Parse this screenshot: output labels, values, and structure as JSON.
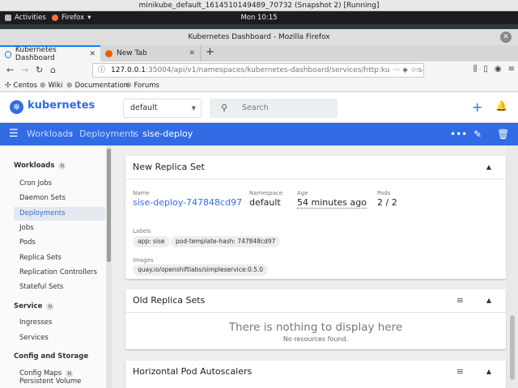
{
  "vm": {
    "title": "minikube_default_1614510149489_70732 (Snapshot 2) [Running]"
  },
  "gnome": {
    "activities": "Activities",
    "app": "Firefox",
    "clock": "Mon 10:15"
  },
  "firefox": {
    "window_title": "Kubernetes Dashboard - Mozilla Firefox",
    "tabs": [
      {
        "label": "Kubernetes Dashboard"
      },
      {
        "label": "New Tab"
      }
    ],
    "url_host": "127.0.0.1",
    "url_path": ":35004/api/v1/namespaces/kubernetes-dashboard/services/http:kubernetes-",
    "bookmarks": [
      {
        "label": "Centos"
      },
      {
        "label": "Wiki"
      },
      {
        "label": "Documentation"
      },
      {
        "label": "Forums"
      }
    ]
  },
  "k8s": {
    "brand": "kubernetes",
    "namespace": "default",
    "search_placeholder": "Search"
  },
  "breadcrumb": {
    "workloads": "Workloads",
    "deployments": "Deployments",
    "current": "sise-deploy"
  },
  "sidebar": {
    "sections": [
      {
        "label": "Workloads",
        "badge": "N"
      },
      {
        "label": "Service",
        "badge": "N"
      },
      {
        "label": "Config and Storage"
      }
    ],
    "items": [
      {
        "label": "Cron Jobs"
      },
      {
        "label": "Daemon Sets"
      },
      {
        "label": "Deployments"
      },
      {
        "label": "Jobs"
      },
      {
        "label": "Pods"
      },
      {
        "label": "Replica Sets"
      },
      {
        "label": "Replication Controllers"
      },
      {
        "label": "Stateful Sets"
      },
      {
        "label": "Ingresses"
      },
      {
        "label": "Services"
      },
      {
        "label": "Config Maps",
        "badge": "N"
      },
      {
        "label": "Persistent Volume Claims"
      }
    ]
  },
  "new_rs": {
    "title": "New Replica Set",
    "name_label": "Name",
    "name": "sise-deploy-747848cd97",
    "namespace_label": "Namespace",
    "namespace": "default",
    "age_label": "Age",
    "age": "54 minutes ago",
    "pods_label": "Pods",
    "pods": "2 / 2",
    "labels_label": "Labels",
    "labels": [
      "app: sise",
      "pod-template-hash: 747848cd97"
    ],
    "images_label": "Images",
    "images": [
      "quay.io/openshiftlabs/simpleservice:0.5.0"
    ]
  },
  "old_rs": {
    "title": "Old Replica Sets",
    "empty_title": "There is nothing to display here",
    "empty_sub": "No resources found."
  },
  "hpa": {
    "title": "Horizontal Pod Autoscalers"
  }
}
